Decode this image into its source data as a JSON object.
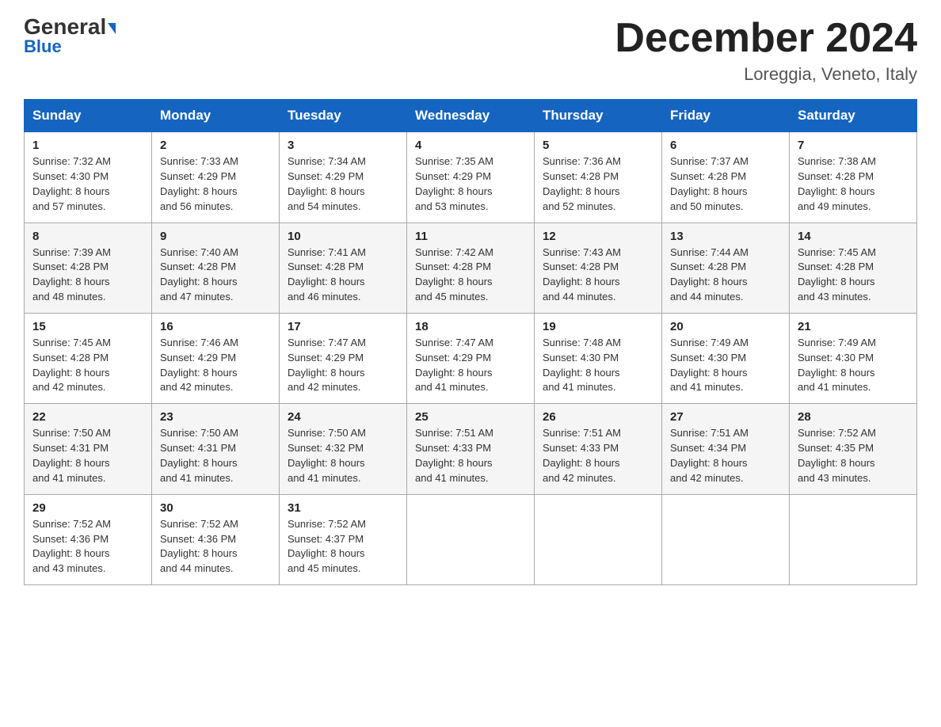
{
  "header": {
    "logo_general": "General",
    "logo_blue": "Blue",
    "month_title": "December 2024",
    "location": "Loreggia, Veneto, Italy"
  },
  "weekdays": [
    "Sunday",
    "Monday",
    "Tuesday",
    "Wednesday",
    "Thursday",
    "Friday",
    "Saturday"
  ],
  "weeks": [
    [
      {
        "day": "1",
        "sunrise": "7:32 AM",
        "sunset": "4:30 PM",
        "daylight": "8 hours and 57 minutes."
      },
      {
        "day": "2",
        "sunrise": "7:33 AM",
        "sunset": "4:29 PM",
        "daylight": "8 hours and 56 minutes."
      },
      {
        "day": "3",
        "sunrise": "7:34 AM",
        "sunset": "4:29 PM",
        "daylight": "8 hours and 54 minutes."
      },
      {
        "day": "4",
        "sunrise": "7:35 AM",
        "sunset": "4:29 PM",
        "daylight": "8 hours and 53 minutes."
      },
      {
        "day": "5",
        "sunrise": "7:36 AM",
        "sunset": "4:28 PM",
        "daylight": "8 hours and 52 minutes."
      },
      {
        "day": "6",
        "sunrise": "7:37 AM",
        "sunset": "4:28 PM",
        "daylight": "8 hours and 50 minutes."
      },
      {
        "day": "7",
        "sunrise": "7:38 AM",
        "sunset": "4:28 PM",
        "daylight": "8 hours and 49 minutes."
      }
    ],
    [
      {
        "day": "8",
        "sunrise": "7:39 AM",
        "sunset": "4:28 PM",
        "daylight": "8 hours and 48 minutes."
      },
      {
        "day": "9",
        "sunrise": "7:40 AM",
        "sunset": "4:28 PM",
        "daylight": "8 hours and 47 minutes."
      },
      {
        "day": "10",
        "sunrise": "7:41 AM",
        "sunset": "4:28 PM",
        "daylight": "8 hours and 46 minutes."
      },
      {
        "day": "11",
        "sunrise": "7:42 AM",
        "sunset": "4:28 PM",
        "daylight": "8 hours and 45 minutes."
      },
      {
        "day": "12",
        "sunrise": "7:43 AM",
        "sunset": "4:28 PM",
        "daylight": "8 hours and 44 minutes."
      },
      {
        "day": "13",
        "sunrise": "7:44 AM",
        "sunset": "4:28 PM",
        "daylight": "8 hours and 44 minutes."
      },
      {
        "day": "14",
        "sunrise": "7:45 AM",
        "sunset": "4:28 PM",
        "daylight": "8 hours and 43 minutes."
      }
    ],
    [
      {
        "day": "15",
        "sunrise": "7:45 AM",
        "sunset": "4:28 PM",
        "daylight": "8 hours and 42 minutes."
      },
      {
        "day": "16",
        "sunrise": "7:46 AM",
        "sunset": "4:29 PM",
        "daylight": "8 hours and 42 minutes."
      },
      {
        "day": "17",
        "sunrise": "7:47 AM",
        "sunset": "4:29 PM",
        "daylight": "8 hours and 42 minutes."
      },
      {
        "day": "18",
        "sunrise": "7:47 AM",
        "sunset": "4:29 PM",
        "daylight": "8 hours and 41 minutes."
      },
      {
        "day": "19",
        "sunrise": "7:48 AM",
        "sunset": "4:30 PM",
        "daylight": "8 hours and 41 minutes."
      },
      {
        "day": "20",
        "sunrise": "7:49 AM",
        "sunset": "4:30 PM",
        "daylight": "8 hours and 41 minutes."
      },
      {
        "day": "21",
        "sunrise": "7:49 AM",
        "sunset": "4:30 PM",
        "daylight": "8 hours and 41 minutes."
      }
    ],
    [
      {
        "day": "22",
        "sunrise": "7:50 AM",
        "sunset": "4:31 PM",
        "daylight": "8 hours and 41 minutes."
      },
      {
        "day": "23",
        "sunrise": "7:50 AM",
        "sunset": "4:31 PM",
        "daylight": "8 hours and 41 minutes."
      },
      {
        "day": "24",
        "sunrise": "7:50 AM",
        "sunset": "4:32 PM",
        "daylight": "8 hours and 41 minutes."
      },
      {
        "day": "25",
        "sunrise": "7:51 AM",
        "sunset": "4:33 PM",
        "daylight": "8 hours and 41 minutes."
      },
      {
        "day": "26",
        "sunrise": "7:51 AM",
        "sunset": "4:33 PM",
        "daylight": "8 hours and 42 minutes."
      },
      {
        "day": "27",
        "sunrise": "7:51 AM",
        "sunset": "4:34 PM",
        "daylight": "8 hours and 42 minutes."
      },
      {
        "day": "28",
        "sunrise": "7:52 AM",
        "sunset": "4:35 PM",
        "daylight": "8 hours and 43 minutes."
      }
    ],
    [
      {
        "day": "29",
        "sunrise": "7:52 AM",
        "sunset": "4:36 PM",
        "daylight": "8 hours and 43 minutes."
      },
      {
        "day": "30",
        "sunrise": "7:52 AM",
        "sunset": "4:36 PM",
        "daylight": "8 hours and 44 minutes."
      },
      {
        "day": "31",
        "sunrise": "7:52 AM",
        "sunset": "4:37 PM",
        "daylight": "8 hours and 45 minutes."
      },
      null,
      null,
      null,
      null
    ]
  ],
  "labels": {
    "sunrise": "Sunrise:",
    "sunset": "Sunset:",
    "daylight": "Daylight:"
  }
}
